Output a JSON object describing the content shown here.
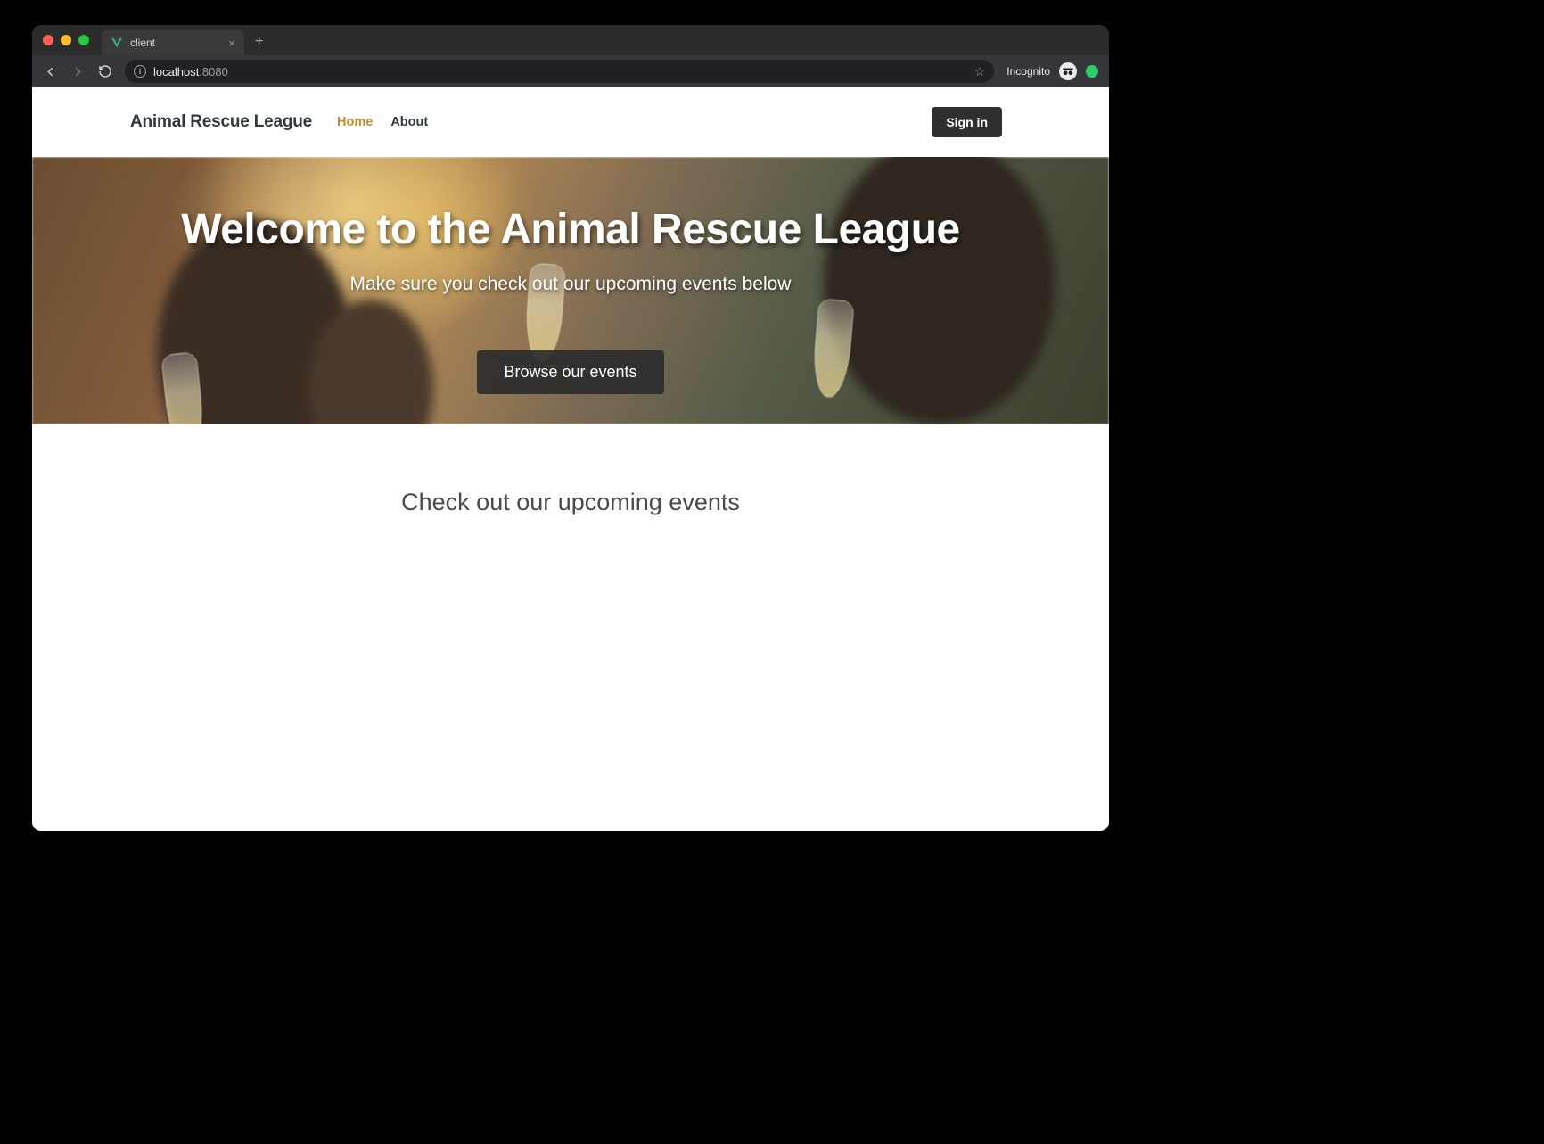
{
  "browser": {
    "tab_title": "client",
    "url_host": "localhost",
    "url_port": ":8080",
    "incognito_label": "Incognito"
  },
  "nav": {
    "brand": "Animal Rescue League",
    "links": [
      {
        "label": "Home",
        "active": true
      },
      {
        "label": "About",
        "active": false
      }
    ],
    "signin_label": "Sign in"
  },
  "hero": {
    "title": "Welcome to the Animal Rescue League",
    "subtitle": "Make sure you check out our upcoming events below",
    "cta_label": "Browse our events"
  },
  "events": {
    "heading": "Check out our upcoming events"
  }
}
